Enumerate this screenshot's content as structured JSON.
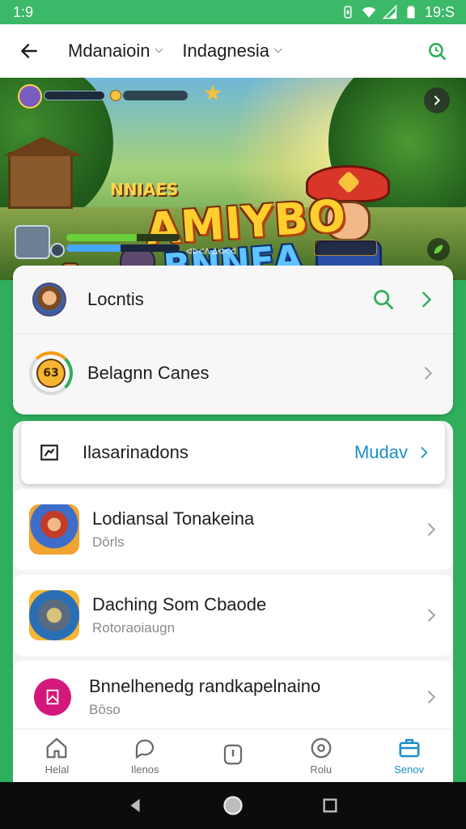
{
  "status_bar": {
    "time_left": "1:9",
    "time_right": "19:S",
    "icons": [
      "vibrate-icon",
      "wifi-icon",
      "signal-icon",
      "battery-icon"
    ]
  },
  "header": {
    "back_icon": "arrow-left-icon",
    "dropdown_1": "Mdanaioin",
    "dropdown_2": "Indagnesia",
    "search_icon": "search-icon"
  },
  "banner": {
    "small_title": "NNIAES",
    "title_line1": "AMIYBO",
    "title_line2": "BNNEA",
    "hud_text": "ᐊᐅᐸᐱ ᐃᐊᐸᐊ",
    "next_icon": "chevron-right-icon",
    "hp_fraction": 0.62,
    "mp_fraction": 0.48
  },
  "top_card": {
    "items": [
      {
        "label": "Locntis",
        "icon": "avatar-icon",
        "action_icon": "search-icon"
      },
      {
        "label": "Belagnn Canes",
        "icon": "badge-icon"
      }
    ]
  },
  "section": {
    "icon": "chart-icon",
    "title": "Ilasarinadons",
    "see_more": "Mudav"
  },
  "games": [
    {
      "title": "Lodiansal Tonakeina",
      "subtitle": "Dōrls"
    },
    {
      "title": "Daching Som Cbaode",
      "subtitle": "Rotoraoiaugn"
    },
    {
      "title": "Bnnelhenedg randkapelnaino",
      "subtitle": "Bōso"
    }
  ],
  "bottom_nav": [
    {
      "label": "Helal",
      "icon": "home-icon"
    },
    {
      "label": "Ilenos",
      "icon": "chat-icon"
    },
    {
      "label": "",
      "icon": "clock-icon"
    },
    {
      "label": "Rolu",
      "icon": "compass-icon"
    },
    {
      "label": "Senov",
      "icon": "briefcase-icon"
    }
  ],
  "colors": {
    "brand_green": "#2fae5c",
    "link_blue": "#1a8fc7"
  }
}
